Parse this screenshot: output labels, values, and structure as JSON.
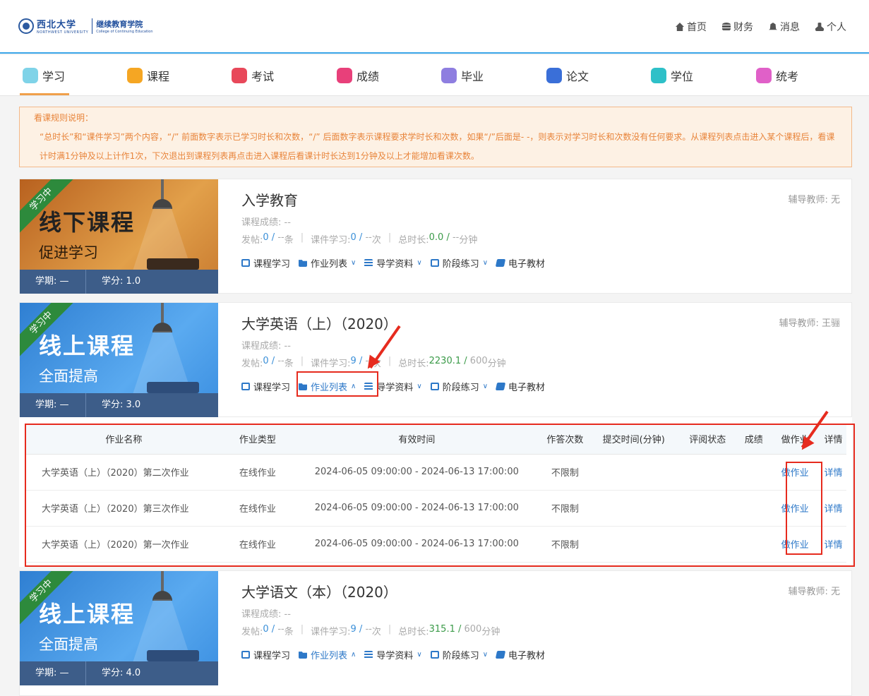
{
  "header": {
    "logo_cn": "西北大学",
    "logo_en": "NORTHWEST UNIVERSITY",
    "college_cn": "继续教育学院",
    "college_en": "College of Continuing Education",
    "nav": [
      {
        "label": "首页",
        "icon": "home-icon"
      },
      {
        "label": "财务",
        "icon": "database-icon"
      },
      {
        "label": "消息",
        "icon": "bell-icon"
      },
      {
        "label": "个人",
        "icon": "user-icon"
      }
    ]
  },
  "tabs": [
    {
      "label": "学习",
      "color": "#7fd3e8",
      "active": true
    },
    {
      "label": "课程",
      "color": "#f5a623"
    },
    {
      "label": "考试",
      "color": "#e8485a"
    },
    {
      "label": "成绩",
      "color": "#e8407a"
    },
    {
      "label": "毕业",
      "color": "#8e7ee0"
    },
    {
      "label": "论文",
      "color": "#3a6fd8"
    },
    {
      "label": "学位",
      "color": "#2ec0c8"
    },
    {
      "label": "统考",
      "color": "#e060c8"
    }
  ],
  "notice": {
    "title": "看课规则说明：",
    "body": "“总时长”和“课件学习”两个内容，“/” 前面数字表示已学习时长和次数，“/” 后面数字表示课程要求学时长和次数，如果“/”后面是- -，则表示对学习时长和次数没有任何要求。从课程列表点击进入某个课程后，看课计时满1分钟及以上计作1次，下次退出到课程列表再点击进入课程后看课计时长达到1分钟及以上才能增加看课次数。"
  },
  "labels": {
    "teacher": "辅导教师: ",
    "score": "课程成绩: ",
    "posts": "发帖: ",
    "posts_unit": " 条",
    "courseware": "课件学习: ",
    "courseware_unit": " 次",
    "total": "总时长: ",
    "total_unit": " 分钟",
    "term": "学期: ",
    "credit": "学分: ",
    "ribbon": "学习中",
    "act_study": "课程学习",
    "act_homework": "作业列表",
    "act_guide": "导学资料",
    "act_practice": "阶段练习",
    "act_ebook": "电子教材"
  },
  "courses": [
    {
      "title": "入学教育",
      "teacher": "无",
      "score": "--",
      "posts_done": "0",
      "posts_req": "--",
      "cw_done": "0",
      "cw_req": "--",
      "total_done": "0.0",
      "total_req": "--",
      "term": "—",
      "credit": "1.0",
      "banner_title": "线下课程",
      "banner_sub": "促进学习",
      "kind": "offline"
    },
    {
      "title": "大学英语（上）（2020）",
      "teacher": "王骊",
      "score": "--",
      "posts_done": "0",
      "posts_req": "--",
      "cw_done": "9",
      "cw_req": "--",
      "total_done": "2230.1",
      "total_req": "600",
      "term": "—",
      "credit": "3.0",
      "banner_title": "线上课程",
      "banner_sub": "全面提高",
      "kind": "online"
    },
    {
      "title": "大学语文（本）（2020）",
      "teacher": "无",
      "score": "--",
      "posts_done": "0",
      "posts_req": "--",
      "cw_done": "9",
      "cw_req": "--",
      "total_done": "315.1",
      "total_req": "600",
      "term": "—",
      "credit": "4.0",
      "banner_title": "线上课程",
      "banner_sub": "全面提高",
      "kind": "online"
    }
  ],
  "homework": {
    "headers": [
      "作业名称",
      "作业类型",
      "有效时间",
      "作答次数",
      "提交时间(分钟)",
      "评阅状态",
      "成绩",
      "做作业",
      "详情"
    ],
    "rows": [
      {
        "name": "大学英语（上）（2020）第二次作业",
        "type": "在线作业",
        "time": "2024-06-05 09:00:00 - 2024-06-13 17:00:00",
        "attempts": "不限制",
        "submit": "",
        "review": "",
        "score": "",
        "do": "做作业",
        "detail": "详情"
      },
      {
        "name": "大学英语（上）（2020）第三次作业",
        "type": "在线作业",
        "time": "2024-06-05 09:00:00 - 2024-06-13 17:00:00",
        "attempts": "不限制",
        "submit": "",
        "review": "",
        "score": "",
        "do": "做作业",
        "detail": "详情"
      },
      {
        "name": "大学英语（上）（2020）第一次作业",
        "type": "在线作业",
        "time": "2024-06-05 09:00:00 - 2024-06-13 17:00:00",
        "attempts": "不限制",
        "submit": "",
        "review": "",
        "score": "",
        "do": "做作业",
        "detail": "详情"
      }
    ]
  },
  "colors": {
    "accent": "#2d78c8",
    "highlight": "#e62b1e",
    "notice_text": "#e8843a"
  }
}
